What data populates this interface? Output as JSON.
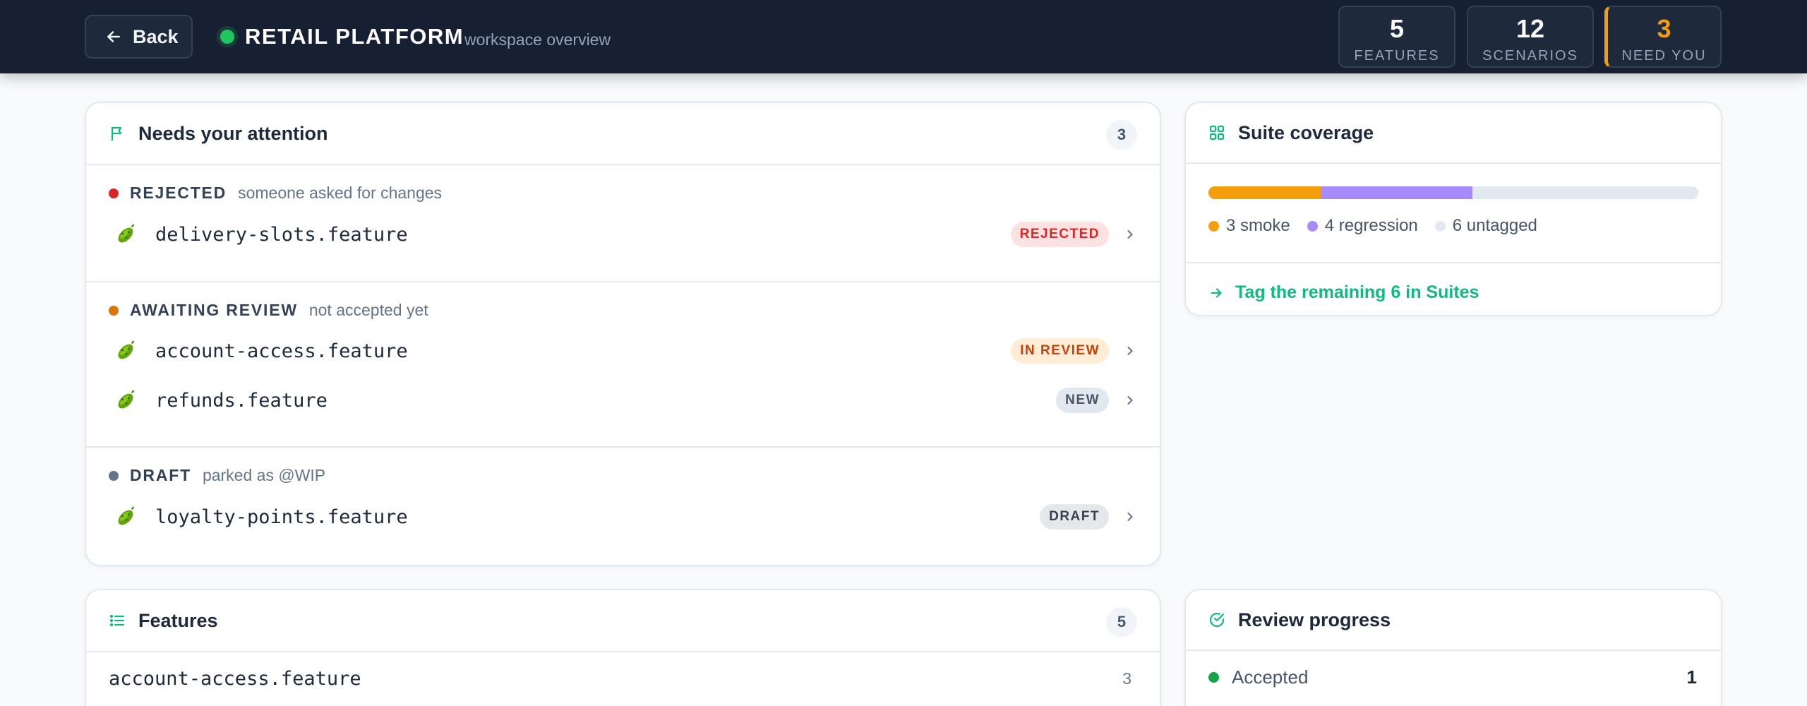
{
  "header": {
    "back_label": "Back",
    "title": "RETAIL PLATFORM",
    "subtitle": "workspace overview",
    "stats": [
      {
        "value": "5",
        "label": "FEATURES"
      },
      {
        "value": "12",
        "label": "SCENARIOS"
      },
      {
        "value": "3",
        "label": "NEED YOU"
      }
    ]
  },
  "attention": {
    "title": "Needs your attention",
    "count": "3",
    "groups": [
      {
        "label": "REJECTED",
        "note": "someone asked for changes",
        "dot_color": "#dc2626",
        "items": [
          {
            "file": "delivery-slots.feature",
            "badge": "REJECTED"
          }
        ]
      },
      {
        "label": "AWAITING REVIEW",
        "note": "not accepted yet",
        "dot_color": "#d97706",
        "items": [
          {
            "file": "account-access.feature",
            "badge": "IN REVIEW"
          },
          {
            "file": "refunds.feature",
            "badge": "NEW"
          }
        ]
      },
      {
        "label": "DRAFT",
        "note": "parked as @WIP",
        "dot_color": "#64748b",
        "items": [
          {
            "file": "loyalty-points.feature",
            "badge": "DRAFT"
          }
        ]
      }
    ]
  },
  "coverage": {
    "title": "Suite coverage",
    "segments": [
      {
        "name": "smoke",
        "value": 3,
        "color": "#f59e0b"
      },
      {
        "name": "regression",
        "value": 4,
        "color": "#a78bfa"
      },
      {
        "name": "untagged",
        "value": 6,
        "color": "#e2e8f0"
      }
    ],
    "legend": [
      "3 smoke",
      "4 regression",
      "6 untagged"
    ],
    "cta": "Tag the remaining 6 in Suites"
  },
  "features": {
    "title": "Features",
    "count": "5",
    "rows": [
      {
        "file": "account-access.feature",
        "scenarios": "3"
      }
    ]
  },
  "review": {
    "title": "Review progress",
    "rows": [
      {
        "label": "Accepted",
        "value": "1"
      }
    ]
  },
  "colors": {
    "accent": "#10b981",
    "header_bg": "#172033",
    "warning": "#f59e0b"
  }
}
